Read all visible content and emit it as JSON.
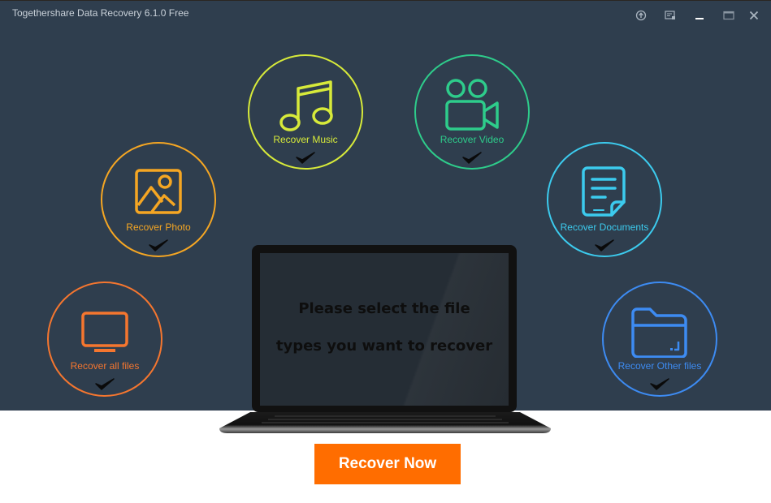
{
  "window": {
    "title": "Togethershare Data Recovery 6.1.0 Free",
    "controls": [
      {
        "name": "upgrade-icon"
      },
      {
        "name": "register-icon"
      },
      {
        "name": "minimize-icon"
      },
      {
        "name": "maximize-icon"
      },
      {
        "name": "close-icon"
      }
    ]
  },
  "categories": [
    {
      "id": "music",
      "label": "Recover Music",
      "color": "#d7ea3a",
      "checked": true,
      "icon": "music-note-icon"
    },
    {
      "id": "video",
      "label": "Recover Video",
      "color": "#2ecc8b",
      "checked": true,
      "icon": "video-camera-icon"
    },
    {
      "id": "photo",
      "label": "Recover Photo",
      "color": "#f5a623",
      "checked": true,
      "icon": "image-icon"
    },
    {
      "id": "documents",
      "label": "Recover Documents",
      "color": "#3ccbee",
      "checked": true,
      "icon": "document-icon"
    },
    {
      "id": "all",
      "label": "Recover all files",
      "color": "#f5762f",
      "checked": true,
      "icon": "monitor-icon"
    },
    {
      "id": "other",
      "label": "Recover Other files",
      "color": "#3d8bf2",
      "checked": true,
      "icon": "folder-icon"
    }
  ],
  "screen": {
    "line1": "Please select the file",
    "line2": "types you want to recover"
  },
  "actions": {
    "recover_now": "Recover Now"
  },
  "colors": {
    "background": "#2f3e4e",
    "accent": "#ff6d00"
  }
}
